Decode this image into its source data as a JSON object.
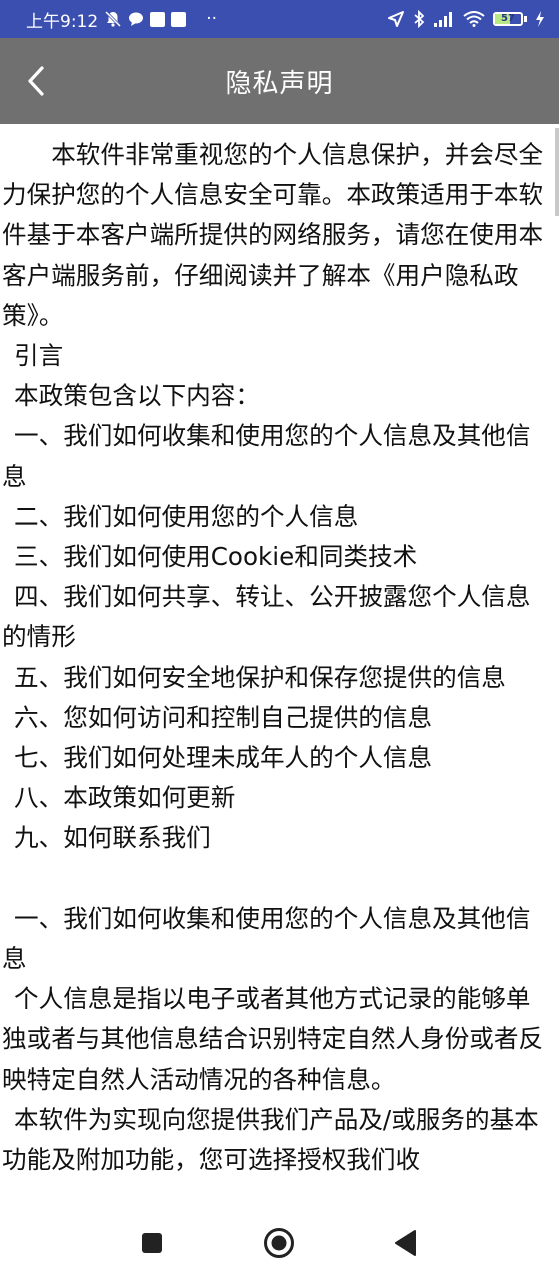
{
  "status_bar": {
    "time": "上午9:12",
    "dots": "··",
    "battery_level": "57",
    "icons": [
      "mute-icon",
      "chat-icon",
      "notification-square-icon",
      "notification-square-icon",
      "location-arrow-icon",
      "bluetooth-icon",
      "signal-icon",
      "wifi-icon",
      "battery-icon",
      "charging-icon"
    ]
  },
  "app_bar": {
    "title": "隐私声明",
    "back_icon": "chevron-left-icon"
  },
  "content": {
    "paragraphs": [
      "本软件非常重视您的个人信息保护，并会尽全力保护您的个人信息安全可靠。本政策适用于本软件基于本客户端所提供的网络服务，请您在使用本客户端服务前，仔细阅读并了解本《用户隐私政策》。",
      "引言",
      "本政策包含以下内容：",
      "一、我们如何收集和使用您的个人信息及其他信息",
      "二、我们如何使用您的个人信息",
      "三、我们如何使用Cookie和同类技术",
      "四、我们如何共享、转让、公开披露您个人信息的情形",
      "五、我们如何安全地保护和保存您提供的信息",
      "六、您如何访问和控制自己提供的信息",
      "七、我们如何处理未成年人的个人信息",
      "八、本政策如何更新",
      "九、如何联系我们",
      "",
      "一、我们如何收集和使用您的个人信息及其他信息",
      "个人信息是指以电子或者其他方式记录的能够单独或者与其他信息结合识别特定自然人身份或者反映特定自然人活动情况的各种信息。",
      "本软件为实现向您提供我们产品及/或服务的基本功能及附加功能，您可选择授权我们收"
    ]
  },
  "nav_bar": {
    "icons": [
      "recents-square-icon",
      "home-circle-icon",
      "back-triangle-icon"
    ]
  },
  "colors": {
    "status_bar": "#3a4fb0",
    "app_bar": "#707070",
    "text": "#111111",
    "background": "#ffffff"
  }
}
